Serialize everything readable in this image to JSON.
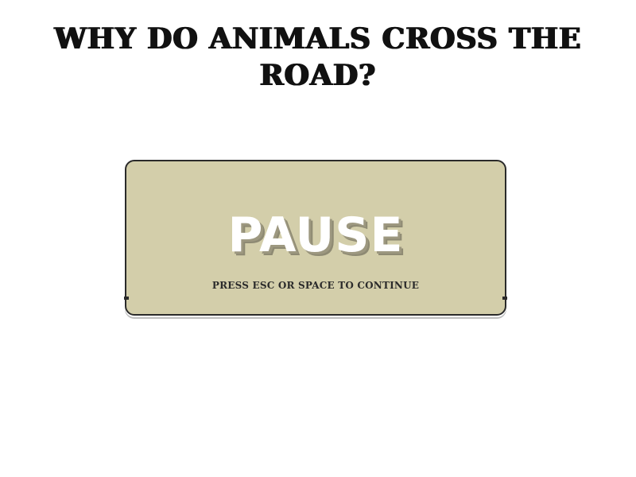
{
  "game": {
    "title": "WHY DO ANIMALS CROSS THE ROAD?"
  },
  "pause_menu": {
    "heading": "PAUSE",
    "hint": "PRESS ESC OR SPACE TO CONTINUE",
    "panel_color": "#d3ceaa"
  }
}
